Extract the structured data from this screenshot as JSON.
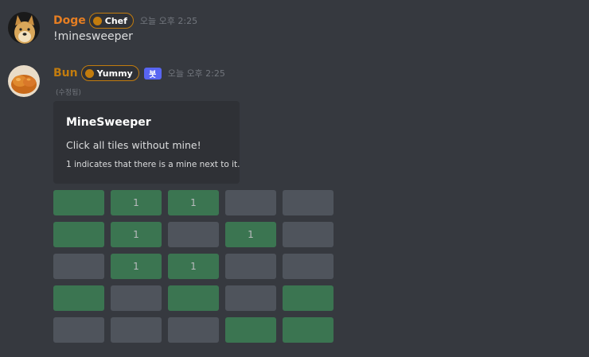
{
  "messages": [
    {
      "username": "Doge",
      "username_color": "#e67e22",
      "role": {
        "label": "Chef",
        "color": "#c27c0e"
      },
      "timestamp": "오늘 오후 2:25",
      "content": "!minesweeper",
      "avatar_icon": "doge-avatar"
    },
    {
      "username": "Bun",
      "username_color": "#c27c0e",
      "role": {
        "label": "Yummy",
        "color": "#c27c0e"
      },
      "bot_tag": "봇",
      "timestamp": "오늘 오후 2:25",
      "edited": "(수정됨)",
      "avatar_icon": "bun-avatar",
      "embed": {
        "title": "MineSweeper",
        "description": "Click all tiles without mine!",
        "note": "1 indicates that there is a mine next to it."
      }
    }
  ],
  "minesweeper": {
    "rows": [
      [
        {
          "label": "",
          "state": "revealed"
        },
        {
          "label": "1",
          "state": "revealed"
        },
        {
          "label": "1",
          "state": "revealed"
        },
        {
          "label": "",
          "state": "hidden"
        },
        {
          "label": "",
          "state": "hidden"
        }
      ],
      [
        {
          "label": "",
          "state": "revealed"
        },
        {
          "label": "1",
          "state": "revealed"
        },
        {
          "label": "",
          "state": "hidden"
        },
        {
          "label": "1",
          "state": "revealed"
        },
        {
          "label": "",
          "state": "hidden"
        }
      ],
      [
        {
          "label": "",
          "state": "hidden"
        },
        {
          "label": "1",
          "state": "revealed"
        },
        {
          "label": "1",
          "state": "revealed"
        },
        {
          "label": "",
          "state": "hidden"
        },
        {
          "label": "",
          "state": "hidden"
        }
      ],
      [
        {
          "label": "",
          "state": "revealed"
        },
        {
          "label": "",
          "state": "hidden"
        },
        {
          "label": "",
          "state": "revealed"
        },
        {
          "label": "",
          "state": "hidden"
        },
        {
          "label": "",
          "state": "revealed"
        }
      ],
      [
        {
          "label": "",
          "state": "hidden"
        },
        {
          "label": "",
          "state": "hidden"
        },
        {
          "label": "",
          "state": "hidden"
        },
        {
          "label": "",
          "state": "revealed"
        },
        {
          "label": "",
          "state": "revealed"
        }
      ]
    ]
  }
}
